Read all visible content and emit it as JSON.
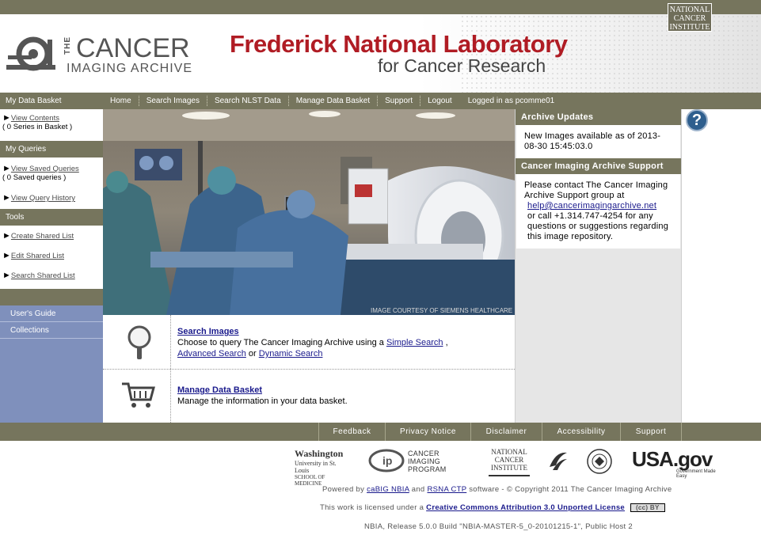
{
  "header": {
    "nci_top_logo": "NATIONAL CANCER INSTITUTE",
    "tcia_the": "THE",
    "tcia_cancer": "CANCER",
    "tcia_archive": "IMAGING ARCHIVE",
    "fnl_title": "Frederick National Laboratory",
    "fnl_subtitle": "for Cancer Research"
  },
  "nav": {
    "items": [
      "Home",
      "Search Images",
      "Search NLST Data",
      "Manage Data Basket",
      "Support",
      "Logout"
    ],
    "logged_in": "Logged in as pcomme01"
  },
  "sidebar": {
    "basket_head": "My Data Basket",
    "view_contents": "View Contents",
    "series_count": "( 0 Series in Basket )",
    "queries_head": "My Queries",
    "view_saved_queries": "View Saved Queries",
    "saved_count": "( 0 Saved queries )",
    "view_query_history": "View Query History",
    "tools_head": "Tools",
    "create_shared": "Create Shared List",
    "edit_shared": "Edit Shared List",
    "search_shared": "Search Shared List",
    "users_guide": "User's Guide",
    "collections": "Collections"
  },
  "banner": {
    "caption": "IMAGE COURTESY OF SIEMENS HEALTHCARE"
  },
  "rows": {
    "search_head": "Search Images",
    "search_text_1": "Choose to query The Cancer Imaging Archive using a",
    "simple_search": "Simple Search",
    "comma": ",",
    "advanced_search": "Advanced Search",
    "or": "or",
    "dynamic_search": "Dynamic Search",
    "basket_head": "Manage Data Basket",
    "basket_text": "Manage the information in your data basket."
  },
  "right": {
    "updates_head": "Archive Updates",
    "updates_text": "New Images available as of 2013-08-30 15:45:03.0",
    "support_head": "Cancer Imaging Archive Support",
    "support_text_1": "Please contact The Cancer Imaging Archive Support group at",
    "support_email": "help@cancerimagingarchive.net",
    "support_text_2": "or call +1.314.747-4254 for any questions or suggestions regarding this image repository."
  },
  "help_icon": "?",
  "footer": {
    "links": [
      "Feedback",
      "Privacy Notice",
      "Disclaimer",
      "Accessibility",
      "Support"
    ],
    "powered_by": "Powered by",
    "cabig": "caBIG NBIA",
    "and": "and",
    "rsna": "RSNA CTP",
    "copyright": "software - © Copyright 2011 The Cancer Imaging Archive",
    "license_prefix": "This work is licensed under a",
    "license_link": "Creative Commons Attribution 3.0 Unported License",
    "cc_badge": "(cc) BY",
    "release": "NBIA, Release 5.0.0 Build \"NBIA-MASTER-5_0-20101215-1\", Public Host 2"
  },
  "partners": {
    "washu_1": "Washington",
    "washu_2": "University in St. Louis",
    "washu_3": "SCHOOL OF MEDICINE",
    "cip_1": "CANCER",
    "cip_2": "IMAGING",
    "cip_3": "PROGRAM",
    "nci": "NATIONAL CANCER INSTITUTE",
    "usagov": "USA.gov",
    "usagov_sub": "Government Made Easy"
  },
  "colors": {
    "olive_bar": "#76755d",
    "sidebar_blue": "#7f90bc",
    "fnl_red": "#b01c24",
    "link_blue": "#1a1a8c"
  }
}
